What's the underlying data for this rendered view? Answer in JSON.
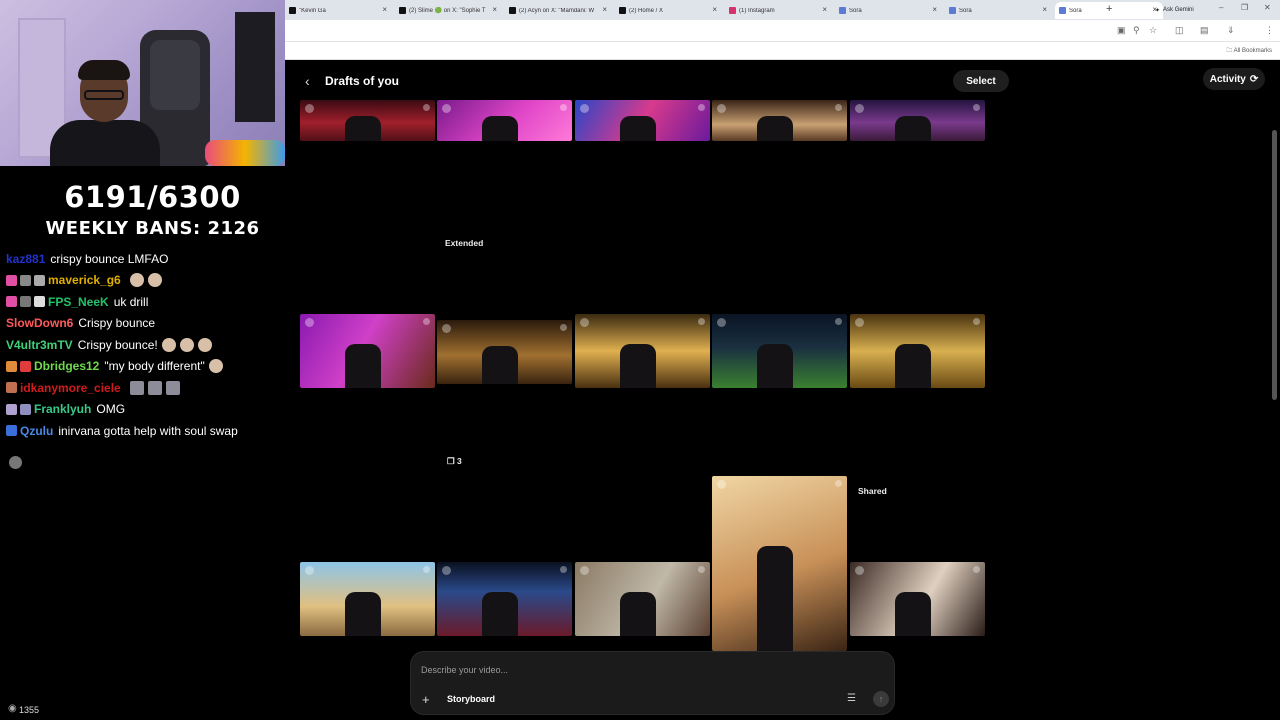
{
  "stream": {
    "sub_count": "6191/6300",
    "weekly_bans": "WEEKLY BANS: 2126",
    "viewer_count": "1355",
    "chat": [
      {
        "user": "kaz881",
        "color": "#2233cc",
        "text": "crispy bounce LMFAO",
        "badges": [],
        "emotes": 0
      },
      {
        "user": "maverick_g6",
        "color": "#e0b000",
        "text": "",
        "badges": [
          "#e04fa4",
          "#888",
          "#aaa"
        ],
        "emotes": 2
      },
      {
        "user": "FPS_NeeK",
        "color": "#23c26b",
        "text": "uk drill",
        "badges": [
          "#e04fa4",
          "#777",
          "#ddd"
        ],
        "emotes": 0
      },
      {
        "user": "SlowDown6",
        "color": "#ff5a5a",
        "text": "Crispy bounce",
        "badges": [],
        "emotes": 0
      },
      {
        "user": "V4ultr3mTV",
        "color": "#3fd07a",
        "text": "Crispy bounce!",
        "badges": [],
        "emotes": 3
      },
      {
        "user": "Dbridges12",
        "color": "#6edb4e",
        "text": "\"my body different\"",
        "badges": [
          "#e08a3c",
          "#e03c3c"
        ],
        "emotes": 1
      },
      {
        "user": "idkanymore_ciele",
        "color": "#d01c1c",
        "text": "",
        "badges": [
          "#c07050"
        ],
        "emotes": 3,
        "emote_style": "sq"
      },
      {
        "user": "Franklyuh",
        "color": "#37c98a",
        "text": "OMG",
        "badges": [
          "#b0a0d0",
          "#9090c0"
        ],
        "emotes": 0
      },
      {
        "user": "Qzulu",
        "color": "#4a88e6",
        "text": "inirvana gotta help with soul swap",
        "badges": [
          "#3a6ed8"
        ],
        "emotes": 0
      }
    ]
  },
  "browser": {
    "tabs": [
      {
        "label": "\"Kevin Ga",
        "icon": "x-icon",
        "left": 0
      },
      {
        "label": "(2) Slime 🟢 on X: \"Sophie T",
        "icon": "x-icon"
      },
      {
        "label": "(2) Acyn on X: \"Mamdani: W",
        "icon": "x-icon"
      },
      {
        "label": "(2) Home / X",
        "icon": "x-icon"
      },
      {
        "label": "(1) Instagram",
        "icon": "instagram-icon"
      },
      {
        "label": "Sora",
        "icon": "sora-icon"
      },
      {
        "label": "Sora",
        "icon": "sora-icon"
      },
      {
        "label": "Sora",
        "icon": "sora-icon",
        "active": true
      }
    ],
    "ask_gemini": "Ask Gemini",
    "all_bookmarks": "All Bookmarks"
  },
  "page": {
    "title": "Drafts of you",
    "select_label": "Select",
    "activity_label": "Activity",
    "extended_label": "Extended",
    "count_label": "3",
    "shared_label": "Shared",
    "prompt_placeholder": "Describe your video...",
    "storyboard_label": "Storyboard"
  },
  "thumbnails": [
    {
      "row": 1,
      "col": 1,
      "desc": "party-red"
    },
    {
      "row": 1,
      "col": 2,
      "desc": "dance-pink"
    },
    {
      "row": 1,
      "col": 3,
      "desc": "neon-blur"
    },
    {
      "row": 1,
      "col": 4,
      "desc": "singer-mic"
    },
    {
      "row": 1,
      "col": 5,
      "desc": "club-crowd"
    },
    {
      "row": 2,
      "col": 1,
      "desc": "beanie-closeup"
    },
    {
      "row": 2,
      "col": 2,
      "desc": "golden-hall-group"
    },
    {
      "row": 2,
      "col": 3,
      "desc": "golden-corridor"
    },
    {
      "row": 2,
      "col": 4,
      "desc": "night-field"
    },
    {
      "row": 2,
      "col": 5,
      "desc": "gold-vault"
    },
    {
      "row": 3,
      "col": 1,
      "desc": "street-parade"
    },
    {
      "row": 3,
      "col": 2,
      "desc": "earth-runway"
    },
    {
      "row": 3,
      "col": 3,
      "desc": "city-couple"
    },
    {
      "row": 3,
      "col": 4,
      "desc": "vintage-singer-portrait"
    },
    {
      "row": 3,
      "col": 5,
      "desc": "studio-singer"
    }
  ]
}
